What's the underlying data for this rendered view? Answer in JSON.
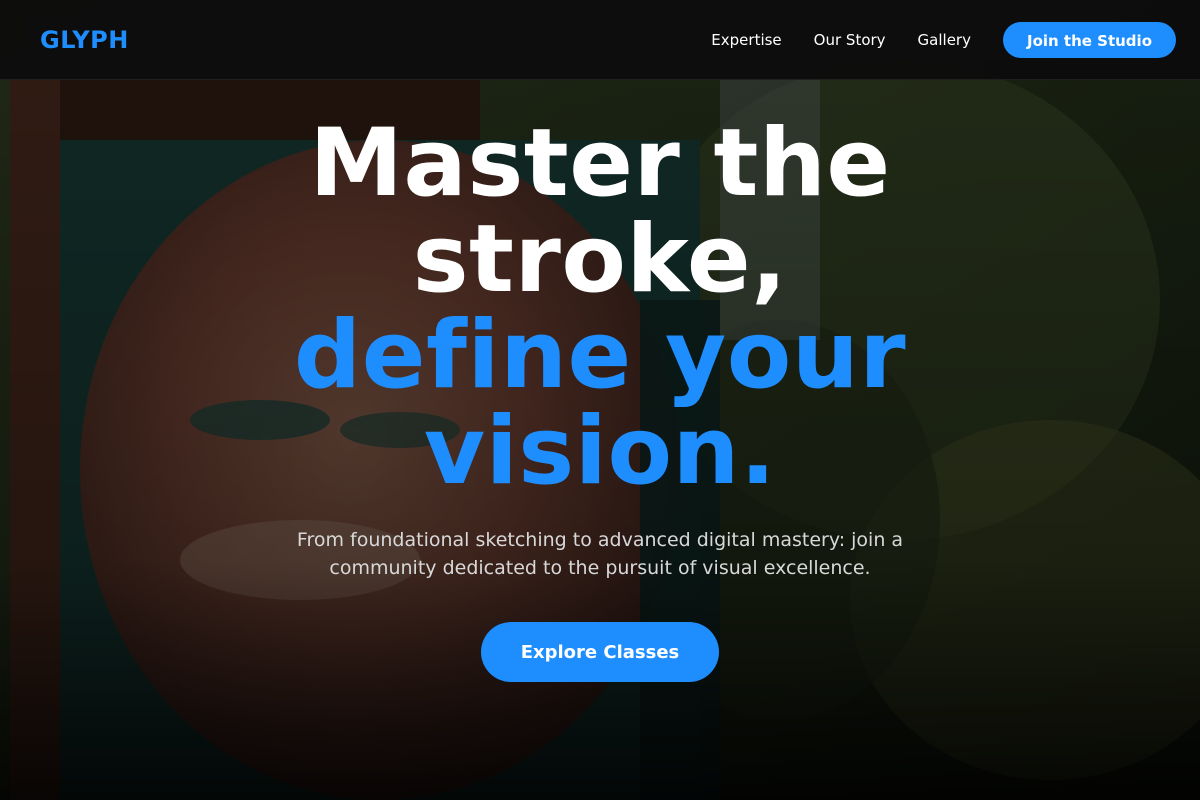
{
  "brand": {
    "name": "GLYPH",
    "accent_color": "#1e8eff"
  },
  "nav": {
    "links": [
      {
        "label": "Expertise"
      },
      {
        "label": "Our Story"
      },
      {
        "label": "Gallery"
      }
    ],
    "cta_label": "Join the Studio"
  },
  "hero": {
    "headline_line1": "Master the",
    "headline_line2": "stroke,",
    "headline_line3": "define your",
    "headline_line4": "vision.",
    "subtext": "From foundational sketching to advanced digital mastery: join a community dedicated to the pursuit of visual excellence.",
    "cta_label": "Explore Classes",
    "background_image": "painted-face-mural-photo"
  }
}
